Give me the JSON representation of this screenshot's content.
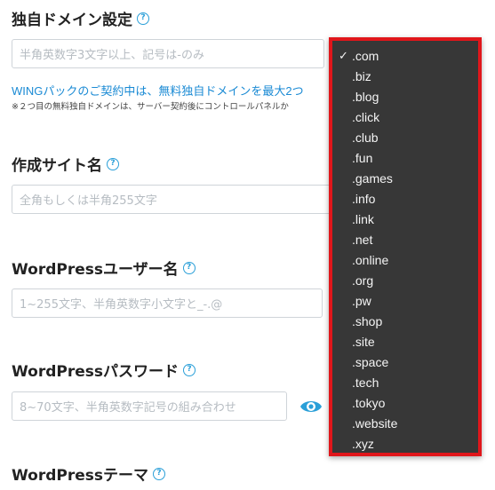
{
  "domain_section": {
    "title": "独自ドメイン設定",
    "input_placeholder": "半角英数字3文字以上、記号は-のみ",
    "promo_link": "WINGパックのご契約中は、無料独自ドメインを最大2つ",
    "note": "※２つ目の無料独自ドメインは、サーバー契約後にコントロールパネルか"
  },
  "site_name": {
    "title": "作成サイト名",
    "placeholder": "全角もしくは半角255文字"
  },
  "wp_user": {
    "title": "WordPressユーザー名",
    "placeholder": "1~255文字、半角英数字小文字と_-.@"
  },
  "wp_password": {
    "title": "WordPressパスワード",
    "placeholder": "8~70文字、半角英数字記号の組み合わせ"
  },
  "wp_theme": {
    "title": "WordPressテーマ"
  },
  "tld_dropdown": {
    "selected": ".com",
    "options": [
      ".com",
      ".biz",
      ".blog",
      ".click",
      ".club",
      ".fun",
      ".games",
      ".info",
      ".link",
      ".net",
      ".online",
      ".org",
      ".pw",
      ".shop",
      ".site",
      ".space",
      ".tech",
      ".tokyo",
      ".website",
      ".xyz"
    ]
  },
  "colors": {
    "accent": "#2a9fd8",
    "link": "#1a8ad4",
    "highlight_border": "#e0161b",
    "dropdown_bg": "#373737"
  }
}
